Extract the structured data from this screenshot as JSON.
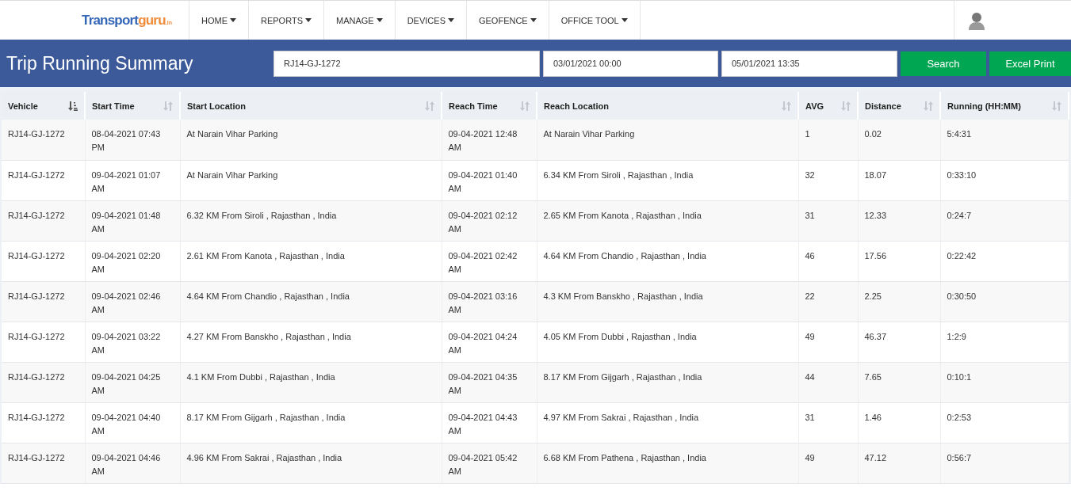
{
  "logo": {
    "part_1": "Transport",
    "part_2": "guru",
    "part_3": ".in"
  },
  "nav": [
    {
      "label": "HOME"
    },
    {
      "label": "REPORTS"
    },
    {
      "label": "MANAGE"
    },
    {
      "label": "DEVICES"
    },
    {
      "label": "GEOFENCE"
    },
    {
      "label": "OFFICE TOOL"
    }
  ],
  "page_title": "Trip Running Summary",
  "filters": {
    "vehicle": "RJ14-GJ-1272",
    "from": "03/01/2021 00:00",
    "to": "05/01/2021 13:35"
  },
  "buttons": [
    "Search",
    "Excel Print"
  ],
  "table": {
    "columns": [
      {
        "label": "Vehicle",
        "sorted": true
      },
      {
        "label": "Start Time",
        "sorted": false
      },
      {
        "label": "Start Location",
        "sorted": false
      },
      {
        "label": "Reach Time",
        "sorted": false
      },
      {
        "label": "Reach Location",
        "sorted": false
      },
      {
        "label": "AVG",
        "sorted": false
      },
      {
        "label": "Distance",
        "sorted": false
      },
      {
        "label": "Running (HH:MM)",
        "sorted": false
      }
    ],
    "rows": [
      [
        "RJ14-GJ-1272",
        "08-04-2021 07:43 PM",
        "At Narain Vihar Parking",
        "09-04-2021 12:48 AM",
        "At Narain Vihar Parking",
        "1",
        "0.02",
        "5:4:31"
      ],
      [
        "RJ14-GJ-1272",
        "09-04-2021 01:07 AM",
        "At Narain Vihar Parking",
        "09-04-2021 01:40 AM",
        "6.34 KM From Siroli , Rajasthan , India",
        "32",
        "18.07",
        "0:33:10"
      ],
      [
        "RJ14-GJ-1272",
        "09-04-2021 01:48 AM",
        "6.32 KM From Siroli , Rajasthan , India",
        "09-04-2021 02:12 AM",
        "2.65 KM From Kanota , Rajasthan , India",
        "31",
        "12.33",
        "0:24:7"
      ],
      [
        "RJ14-GJ-1272",
        "09-04-2021 02:20 AM",
        "2.61 KM From Kanota , Rajasthan , India",
        "09-04-2021 02:42 AM",
        "4.64 KM From Chandio , Rajasthan , India",
        "46",
        "17.56",
        "0:22:42"
      ],
      [
        "RJ14-GJ-1272",
        "09-04-2021 02:46 AM",
        "4.64 KM From Chandio , Rajasthan , India",
        "09-04-2021 03:16 AM",
        "4.3 KM From Banskho , Rajasthan , India",
        "22",
        "2.25",
        "0:30:50"
      ],
      [
        "RJ14-GJ-1272",
        "09-04-2021 03:22 AM",
        "4.27 KM From Banskho , Rajasthan , India",
        "09-04-2021 04:24 AM",
        "4.05 KM From Dubbi , Rajasthan , India",
        "49",
        "46.37",
        "1:2:9"
      ],
      [
        "RJ14-GJ-1272",
        "09-04-2021 04:25 AM",
        "4.1 KM From Dubbi , Rajasthan , India",
        "09-04-2021 04:35 AM",
        "8.17 KM From Gijgarh , Rajasthan , India",
        "44",
        "7.65",
        "0:10:1"
      ],
      [
        "RJ14-GJ-1272",
        "09-04-2021 04:40 AM",
        "8.17 KM From Gijgarh , Rajasthan , India",
        "09-04-2021 04:43 AM",
        "4.97 KM From Sakrai , Rajasthan , India",
        "31",
        "1.46",
        "0:2:53"
      ],
      [
        "RJ14-GJ-1272",
        "09-04-2021 04:46 AM",
        "4.96 KM From Sakrai , Rajasthan , India",
        "09-04-2021 05:42 AM",
        "6.68 KM From Pathena , Rajasthan , India",
        "49",
        "47.12",
        "0:56:7"
      ]
    ]
  }
}
